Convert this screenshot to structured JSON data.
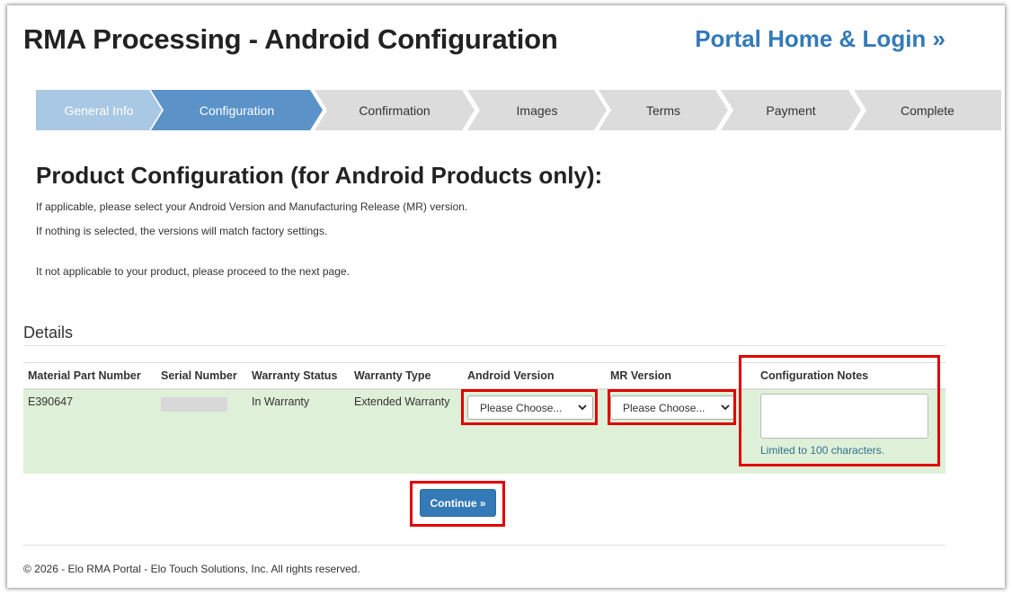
{
  "page": {
    "title": "RMA Processing - Android Configuration",
    "portal_link": "Portal Home & Login »"
  },
  "steps": [
    {
      "label": "General Info",
      "state": "done"
    },
    {
      "label": "Configuration",
      "state": "active"
    },
    {
      "label": "Confirmation",
      "state": "pending"
    },
    {
      "label": "Images",
      "state": "pending"
    },
    {
      "label": "Terms",
      "state": "pending"
    },
    {
      "label": "Payment",
      "state": "pending"
    },
    {
      "label": "Complete",
      "state": "pending"
    }
  ],
  "section": {
    "heading": "Product Configuration (for Android Products only):",
    "line1": "If applicable, please select your Android Version and Manufacturing Release (MR) version.",
    "line2": "If nothing is selected, the versions will match factory settings.",
    "line3": "It not applicable to your product, please proceed to the next page."
  },
  "details": {
    "label": "Details",
    "columns": [
      "Material Part Number",
      "Serial Number",
      "Warranty Status",
      "Warranty Type",
      "Android Version",
      "MR Version",
      "Configuration Notes"
    ],
    "row": {
      "material_part_number": "E390647",
      "serial_number": "",
      "warranty_status": "In Warranty",
      "warranty_type": "Extended Warranty",
      "android_version": "Please Choose...",
      "mr_version": "Please Choose...",
      "notes_value": "",
      "notes_hint": "Limited to 100 characters."
    }
  },
  "continue_label": "Continue »",
  "footer": "© 2026 - Elo RMA Portal - Elo Touch Solutions, Inc. All rights reserved.",
  "colors": {
    "link": "#337ab7",
    "step_done": "#a9c8e4",
    "step_active": "#5b92c8",
    "step_pending": "#dcdcdc",
    "row_success": "#dff0d8",
    "highlight": "#e00000"
  }
}
